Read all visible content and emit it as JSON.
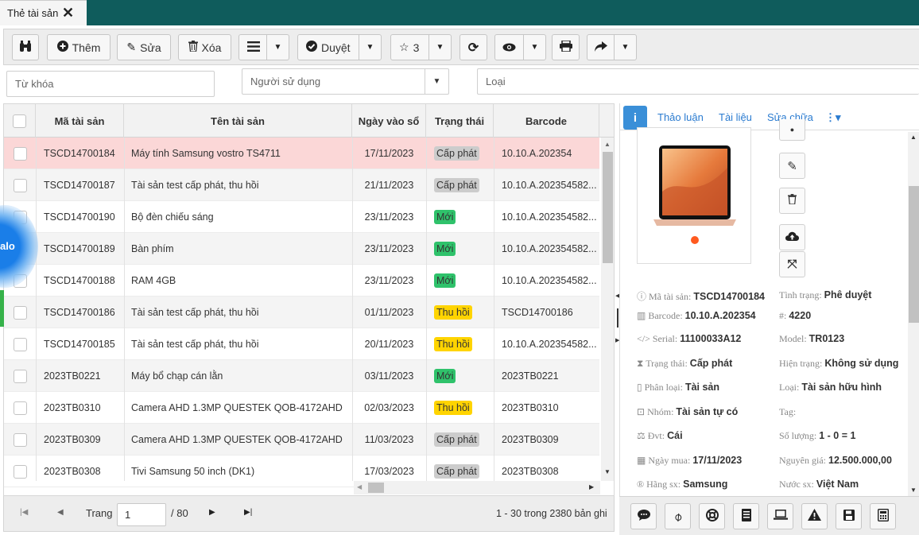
{
  "tab": {
    "title": "Thẻ tài sản",
    "close": "✕"
  },
  "toolbar": {
    "add": "Thêm",
    "edit": "Sửa",
    "delete": "Xóa",
    "approve": "Duyệt",
    "rating": "3"
  },
  "filters": {
    "keyword_placeholder": "Từ khóa",
    "user_placeholder": "Người sử dụng",
    "type_placeholder": "Loại"
  },
  "grid": {
    "columns": [
      "Mã tài sản",
      "Tên tài sản",
      "Ngày vào sổ",
      "Trạng thái",
      "Barcode"
    ],
    "rows": [
      {
        "code": "TSCD14700184",
        "name": "Máy tính Samsung vostro TS4711",
        "date": "17/11/2023",
        "status": "Cấp phát",
        "status_color": "gray",
        "barcode": "10.10.A.202354",
        "selected": true
      },
      {
        "code": "TSCD14700187",
        "name": "Tài sản test cấp phát, thu hồi",
        "date": "21/11/2023",
        "status": "Cấp phát",
        "status_color": "gray",
        "barcode": "10.10.A.202354582..."
      },
      {
        "code": "TSCD14700190",
        "name": "Bộ đèn chiếu sáng",
        "date": "23/11/2023",
        "status": "Mới",
        "status_color": "green",
        "barcode": "10.10.A.202354582..."
      },
      {
        "code": "TSCD14700189",
        "name": "Bàn phím",
        "date": "23/11/2023",
        "status": "Mới",
        "status_color": "green",
        "barcode": "10.10.A.202354582..."
      },
      {
        "code": "TSCD14700188",
        "name": "RAM 4GB",
        "date": "23/11/2023",
        "status": "Mới",
        "status_color": "green",
        "barcode": "10.10.A.202354582..."
      },
      {
        "code": "TSCD14700186",
        "name": "Tài sản test cấp phát, thu hồi",
        "date": "01/11/2023",
        "status": "Thu hồi",
        "status_color": "yellow",
        "barcode": "TSCD14700186"
      },
      {
        "code": "TSCD14700185",
        "name": "Tài sản test cấp phát, thu hồi",
        "date": "20/11/2023",
        "status": "Thu hồi",
        "status_color": "yellow",
        "barcode": "10.10.A.202354582..."
      },
      {
        "code": "2023TB0221",
        "name": "Máy bổ chạp cán lằn",
        "date": "03/11/2023",
        "status": "Mới",
        "status_color": "green",
        "barcode": "2023TB0221"
      },
      {
        "code": "2023TB0310",
        "name": "Camera AHD 1.3MP QUESTEK QOB-4172AHD",
        "date": "02/03/2023",
        "status": "Thu hồi",
        "status_color": "yellow",
        "barcode": "2023TB0310"
      },
      {
        "code": "2023TB0309",
        "name": "Camera AHD 1.3MP QUESTEK QOB-4172AHD",
        "date": "11/03/2023",
        "status": "Cấp phát",
        "status_color": "gray",
        "barcode": "2023TB0309"
      },
      {
        "code": "2023TB0308",
        "name": "Tivi Samsung 50 inch (DK1)",
        "date": "17/03/2023",
        "status": "Cấp phát",
        "status_color": "gray",
        "barcode": "2023TB0308"
      }
    ]
  },
  "pager": {
    "page_label": "Trang",
    "page_value": "1",
    "total_pages": "/ 80",
    "summary": "1 - 30 trong 2380 bản ghi"
  },
  "detail": {
    "tabs": [
      "Thảo luận",
      "Tài liệu",
      "Sửa chữa"
    ],
    "props": {
      "code_label": "Mã tài sản:",
      "code": "TSCD14700184",
      "state_label": "Tình trạng:",
      "state": "Phê duyệt",
      "barcode_label": "Barcode:",
      "barcode": "10.10.A.202354",
      "num_label": "#:",
      "num": "4220",
      "serial_label": "Serial:",
      "serial": "11100033A12",
      "model_label": "Model:",
      "model": "TR0123",
      "status_label": "Trạng thái:",
      "status": "Cấp phát",
      "current_label": "Hiện trạng:",
      "current": "Không sử dụng",
      "class_label": "Phân loại:",
      "class": "Tài sản",
      "type_label": "Loại:",
      "type": "Tài sản hữu hình",
      "group_label": "Nhóm:",
      "group": "Tài sản tự có",
      "tag_label": "Tag:",
      "unit_label": "Đvt:",
      "unit": "Cái",
      "qty_label": "Số lượng:",
      "qty": "1 - 0 = 1",
      "buy_label": "Ngày mua:",
      "buy": "17/11/2023",
      "price_label": "Nguyên giá:",
      "price": "12.500.000,00",
      "brand_label": "Hãng sx:",
      "brand": "Samsung",
      "country_label": "Nước sx:",
      "country": "Việt Nam"
    }
  },
  "zalo": {
    "label": "alo"
  }
}
